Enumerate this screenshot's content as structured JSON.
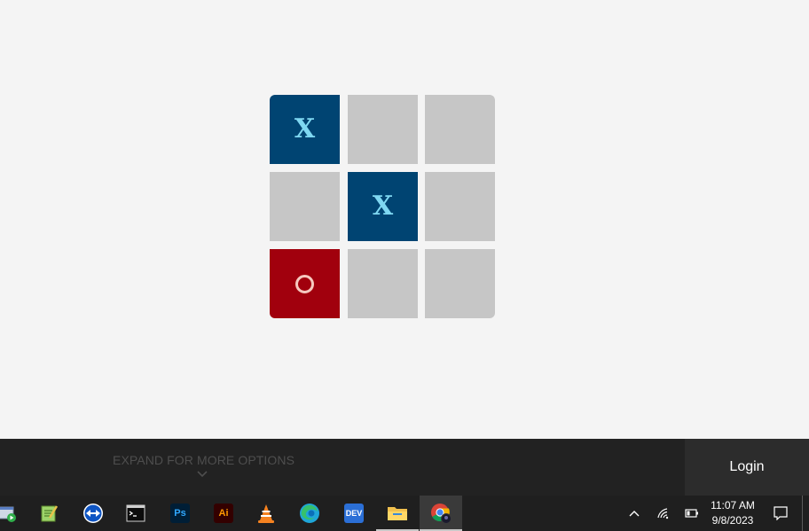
{
  "board": {
    "cells": [
      "X",
      "",
      "",
      "",
      "X",
      "",
      "O",
      "",
      ""
    ]
  },
  "panel": {
    "expand_label": "EXPAND FOR MORE OPTIONS",
    "login_label": "Login"
  },
  "taskbar": {
    "apps": [
      {
        "name": "app-generic-icon"
      },
      {
        "name": "notepad-plus-icon"
      },
      {
        "name": "teamviewer-icon"
      },
      {
        "name": "terminal-icon"
      },
      {
        "name": "photoshop-icon",
        "text": "Ps"
      },
      {
        "name": "illustrator-icon",
        "text": "Ai"
      },
      {
        "name": "vlc-icon"
      },
      {
        "name": "edge-icon"
      },
      {
        "name": "dev-icon",
        "text": "DEV"
      },
      {
        "name": "file-explorer-icon"
      },
      {
        "name": "chrome-icon"
      }
    ],
    "time": "11:07 AM",
    "date": "9/8/2023"
  },
  "colors": {
    "x_cell": "#004472",
    "o_cell": "#a1000d",
    "empty_cell": "#c6c6c6",
    "x_mark": "#7fd8f2",
    "o_mark": "#f6c9bf"
  }
}
